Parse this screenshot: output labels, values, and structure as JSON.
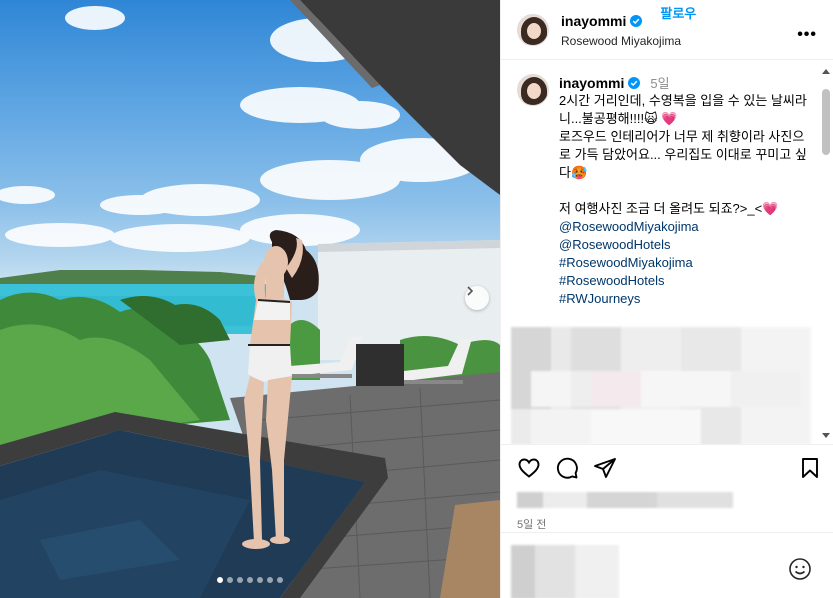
{
  "post": {
    "username": "inayommi",
    "location": "Rosewood Miyakojima",
    "follow_label": "팔로우",
    "more_label": "•••"
  },
  "caption": {
    "username": "inayommi",
    "time": "5일",
    "text": "2시간 거리인데, 수영복을 입을 수 있는 날씨라니...불공평해!!!!🙀 💗\n로즈우드 인테리어가 너무 제 취향이라 사진으로 가득 담았어요... 우리집도 이대로 꾸미고 싶다🥵\n\n저 여행사진 조금 더 올려도 되죠?>_<💗",
    "tags": [
      "@RosewoodMiyakojima",
      "@RosewoodHotels",
      "#RosewoodMiyakojima",
      "#RosewoodHotels",
      "#RWJourneys"
    ]
  },
  "footer": {
    "date": "5일 전"
  },
  "carousel": {
    "slide_count": 7,
    "active_index": 0
  },
  "icons": [
    "verified-badge-icon",
    "heart-icon",
    "comment-icon",
    "share-icon",
    "bookmark-icon",
    "emoji-icon",
    "chevron-right-icon",
    "more-icon"
  ],
  "colors": {
    "accent": "#0095f6",
    "link": "#00376b",
    "muted": "#8e8e8e"
  }
}
